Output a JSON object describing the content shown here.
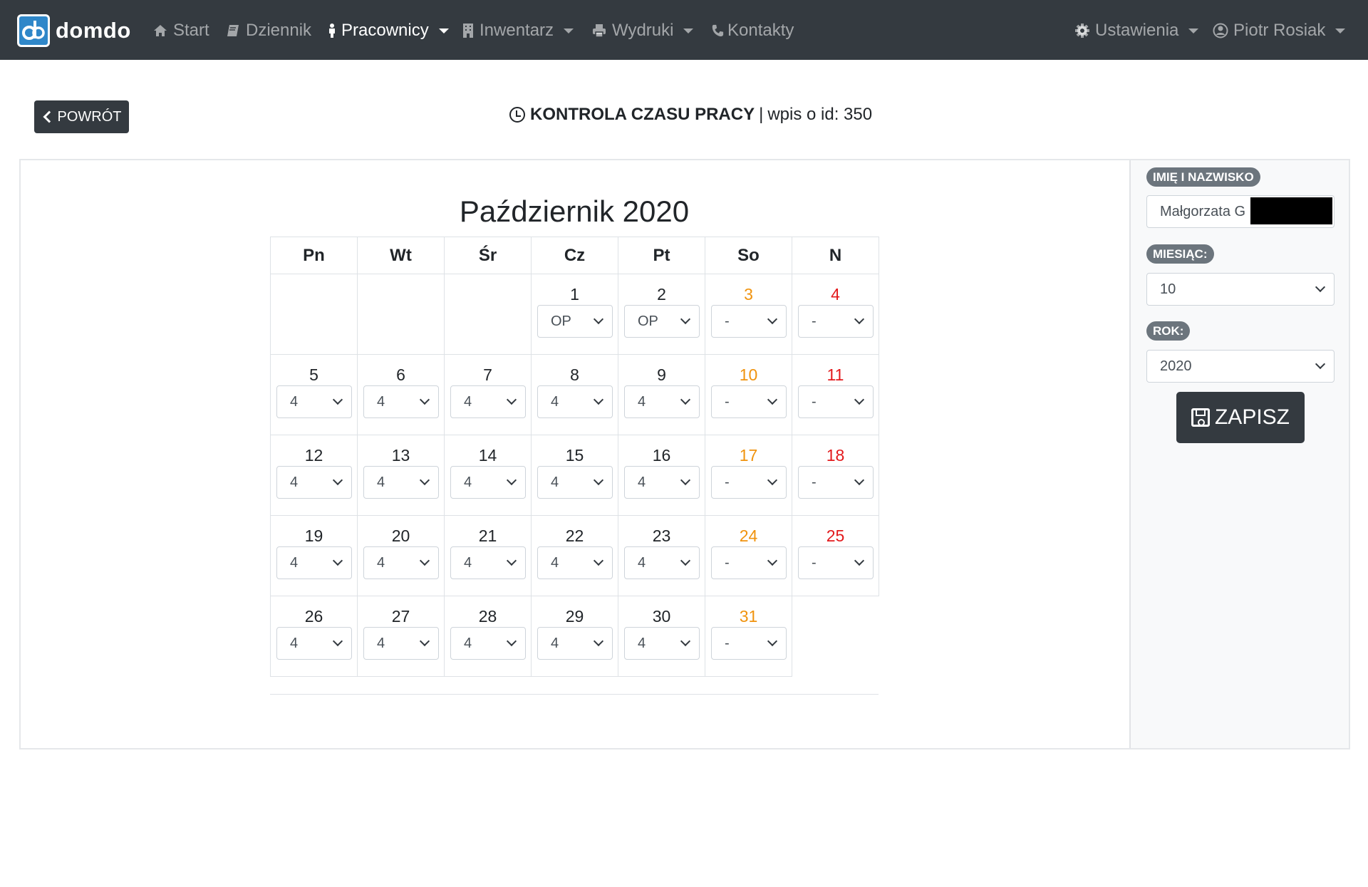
{
  "nav": {
    "brand": "domdo",
    "items": [
      {
        "label": "Start",
        "icon": "home-icon"
      },
      {
        "label": "Dziennik",
        "icon": "book-icon"
      },
      {
        "label": "Pracownicy",
        "icon": "person-icon"
      },
      {
        "label": "Inwentarz",
        "icon": "building-icon"
      },
      {
        "label": "Wydruki",
        "icon": "print-icon"
      },
      {
        "label": "Kontakty",
        "icon": "phone-icon"
      }
    ],
    "settings": "Ustawienia",
    "user": "Piotr Rosiak"
  },
  "header": {
    "back": "POWRÓT",
    "title": "KONTROLA CZASU PRACY",
    "separator": "|",
    "subtitle": "wpis o id: 350"
  },
  "calendar": {
    "title": "Październik 2020",
    "weekdays": [
      "Pn",
      "Wt",
      "Śr",
      "Cz",
      "Pt",
      "So",
      "N"
    ],
    "weeks": [
      [
        null,
        null,
        null,
        {
          "day": "1",
          "value": "OP"
        },
        {
          "day": "2",
          "value": "OP"
        },
        {
          "day": "3",
          "value": "-"
        },
        {
          "day": "4",
          "value": "-"
        }
      ],
      [
        {
          "day": "5",
          "value": "4"
        },
        {
          "day": "6",
          "value": "4"
        },
        {
          "day": "7",
          "value": "4"
        },
        {
          "day": "8",
          "value": "4"
        },
        {
          "day": "9",
          "value": "4"
        },
        {
          "day": "10",
          "value": "-"
        },
        {
          "day": "11",
          "value": "-"
        }
      ],
      [
        {
          "day": "12",
          "value": "4"
        },
        {
          "day": "13",
          "value": "4"
        },
        {
          "day": "14",
          "value": "4"
        },
        {
          "day": "15",
          "value": "4"
        },
        {
          "day": "16",
          "value": "4"
        },
        {
          "day": "17",
          "value": "-"
        },
        {
          "day": "18",
          "value": "-"
        }
      ],
      [
        {
          "day": "19",
          "value": "4"
        },
        {
          "day": "20",
          "value": "4"
        },
        {
          "day": "21",
          "value": "4"
        },
        {
          "day": "22",
          "value": "4"
        },
        {
          "day": "23",
          "value": "4"
        },
        {
          "day": "24",
          "value": "-"
        },
        {
          "day": "25",
          "value": "-"
        }
      ],
      [
        {
          "day": "26",
          "value": "4"
        },
        {
          "day": "27",
          "value": "4"
        },
        {
          "day": "28",
          "value": "4"
        },
        {
          "day": "29",
          "value": "4"
        },
        {
          "day": "30",
          "value": "4"
        },
        {
          "day": "31",
          "value": "-"
        },
        null
      ]
    ]
  },
  "form": {
    "name_label": "IMIĘ I NAZWISKO",
    "name_value": "Małgorzata G",
    "month_label": "MIESIĄC:",
    "month_value": "10",
    "year_label": "ROK:",
    "year_value": "2020",
    "save": "ZAPISZ"
  },
  "colors": {
    "navbar": "#343a40",
    "saturday": "#f0930e",
    "sunday": "#e3191c",
    "badge": "#6c757d"
  }
}
